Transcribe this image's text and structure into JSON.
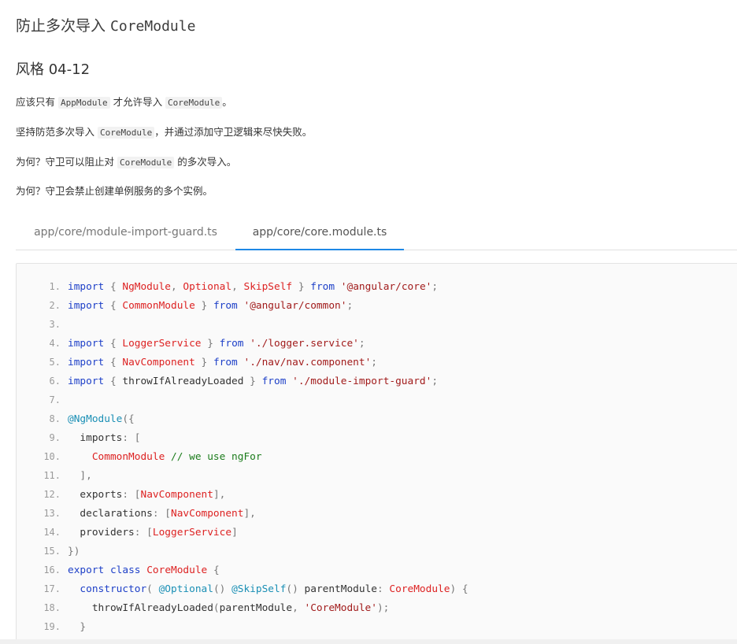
{
  "title": {
    "text": "防止多次导入 ",
    "code": "CoreModule"
  },
  "style_heading": "风格 04-12",
  "paragraphs": [
    {
      "pre": "应该只有 ",
      "code1": "AppModule",
      "mid": " 才允许导入 ",
      "code2": "CoreModule",
      "post": "。"
    },
    {
      "pre": "坚持防范多次导入 ",
      "code1": "CoreModule",
      "post": "，并通过添加守卫逻辑来尽快失败。"
    },
    {
      "pre": "为何？守卫可以阻止对 ",
      "code1": "CoreModule",
      "post": " 的多次导入。"
    },
    {
      "text": "为何？守卫会禁止创建单例服务的多个实例。"
    }
  ],
  "tabs": [
    {
      "label": "app/core/module-import-guard.ts",
      "active": false
    },
    {
      "label": "app/core/core.module.ts",
      "active": true
    }
  ],
  "code_lines": [
    {
      "n": "1.",
      "indent": 0,
      "tokens": [
        [
          "kw",
          "import"
        ],
        [
          "pun",
          " { "
        ],
        [
          "nm",
          "NgModule"
        ],
        [
          "pun",
          ", "
        ],
        [
          "nm",
          "Optional"
        ],
        [
          "pun",
          ", "
        ],
        [
          "nm",
          "SkipSelf"
        ],
        [
          "pun",
          " } "
        ],
        [
          "kw",
          "from"
        ],
        [
          "pun",
          " "
        ],
        [
          "str",
          "'@angular/core'"
        ],
        [
          "pun",
          ";"
        ]
      ]
    },
    {
      "n": "2.",
      "indent": 0,
      "tokens": [
        [
          "kw",
          "import"
        ],
        [
          "pun",
          " { "
        ],
        [
          "nm",
          "CommonModule"
        ],
        [
          "pun",
          " } "
        ],
        [
          "kw",
          "from"
        ],
        [
          "pun",
          " "
        ],
        [
          "str",
          "'@angular/common'"
        ],
        [
          "pun",
          ";"
        ]
      ]
    },
    {
      "n": "3.",
      "indent": 0,
      "tokens": []
    },
    {
      "n": "4.",
      "indent": 0,
      "tokens": [
        [
          "kw",
          "import"
        ],
        [
          "pun",
          " { "
        ],
        [
          "nm",
          "LoggerService"
        ],
        [
          "pun",
          " } "
        ],
        [
          "kw",
          "from"
        ],
        [
          "pun",
          " "
        ],
        [
          "str",
          "'./logger.service'"
        ],
        [
          "pun",
          ";"
        ]
      ]
    },
    {
      "n": "5.",
      "indent": 0,
      "tokens": [
        [
          "kw",
          "import"
        ],
        [
          "pun",
          " { "
        ],
        [
          "nm",
          "NavComponent"
        ],
        [
          "pun",
          " } "
        ],
        [
          "kw",
          "from"
        ],
        [
          "pun",
          " "
        ],
        [
          "str",
          "'./nav/nav.component'"
        ],
        [
          "pun",
          ";"
        ]
      ]
    },
    {
      "n": "6.",
      "indent": 0,
      "tokens": [
        [
          "kw",
          "import"
        ],
        [
          "pun",
          " { "
        ],
        [
          "pl",
          "throwIfAlreadyLoaded"
        ],
        [
          "pun",
          " } "
        ],
        [
          "kw",
          "from"
        ],
        [
          "pun",
          " "
        ],
        [
          "str",
          "'./module-import-guard'"
        ],
        [
          "pun",
          ";"
        ]
      ]
    },
    {
      "n": "7.",
      "indent": 0,
      "tokens": []
    },
    {
      "n": "8.",
      "indent": 0,
      "tokens": [
        [
          "dec",
          "@NgModule"
        ],
        [
          "pun",
          "({"
        ]
      ]
    },
    {
      "n": "9.",
      "indent": 2,
      "tokens": [
        [
          "pl",
          "imports"
        ],
        [
          "pun",
          ": ["
        ]
      ]
    },
    {
      "n": "10.",
      "indent": 4,
      "tokens": [
        [
          "nm",
          "CommonModule"
        ],
        [
          "pun",
          " "
        ],
        [
          "cm",
          "// we use ngFor"
        ]
      ]
    },
    {
      "n": "11.",
      "indent": 2,
      "tokens": [
        [
          "pun",
          "],"
        ]
      ]
    },
    {
      "n": "12.",
      "indent": 2,
      "tokens": [
        [
          "pl",
          "exports"
        ],
        [
          "pun",
          ": ["
        ],
        [
          "nm",
          "NavComponent"
        ],
        [
          "pun",
          "],"
        ]
      ]
    },
    {
      "n": "13.",
      "indent": 2,
      "tokens": [
        [
          "pl",
          "declarations"
        ],
        [
          "pun",
          ": ["
        ],
        [
          "nm",
          "NavComponent"
        ],
        [
          "pun",
          "],"
        ]
      ]
    },
    {
      "n": "14.",
      "indent": 2,
      "tokens": [
        [
          "pl",
          "providers"
        ],
        [
          "pun",
          ": ["
        ],
        [
          "nm",
          "LoggerService"
        ],
        [
          "pun",
          "]"
        ]
      ]
    },
    {
      "n": "15.",
      "indent": 0,
      "tokens": [
        [
          "pun",
          "})"
        ]
      ]
    },
    {
      "n": "16.",
      "indent": 0,
      "tokens": [
        [
          "kw",
          "export"
        ],
        [
          "pun",
          " "
        ],
        [
          "kw",
          "class"
        ],
        [
          "pun",
          " "
        ],
        [
          "nm",
          "CoreModule"
        ],
        [
          "pun",
          " {"
        ]
      ]
    },
    {
      "n": "17.",
      "indent": 2,
      "tokens": [
        [
          "kw",
          "constructor"
        ],
        [
          "pun",
          "( "
        ],
        [
          "dec",
          "@Optional"
        ],
        [
          "pun",
          "() "
        ],
        [
          "dec",
          "@SkipSelf"
        ],
        [
          "pun",
          "() "
        ],
        [
          "pl",
          "parentModule"
        ],
        [
          "pun",
          ": "
        ],
        [
          "nm",
          "CoreModule"
        ],
        [
          "pun",
          ") {"
        ]
      ]
    },
    {
      "n": "18.",
      "indent": 4,
      "tokens": [
        [
          "pl",
          "throwIfAlreadyLoaded"
        ],
        [
          "pun",
          "("
        ],
        [
          "pl",
          "parentModule"
        ],
        [
          "pun",
          ", "
        ],
        [
          "str",
          "'CoreModule'"
        ],
        [
          "pun",
          ");"
        ]
      ]
    },
    {
      "n": "19.",
      "indent": 2,
      "tokens": [
        [
          "pun",
          "}"
        ]
      ]
    }
  ]
}
